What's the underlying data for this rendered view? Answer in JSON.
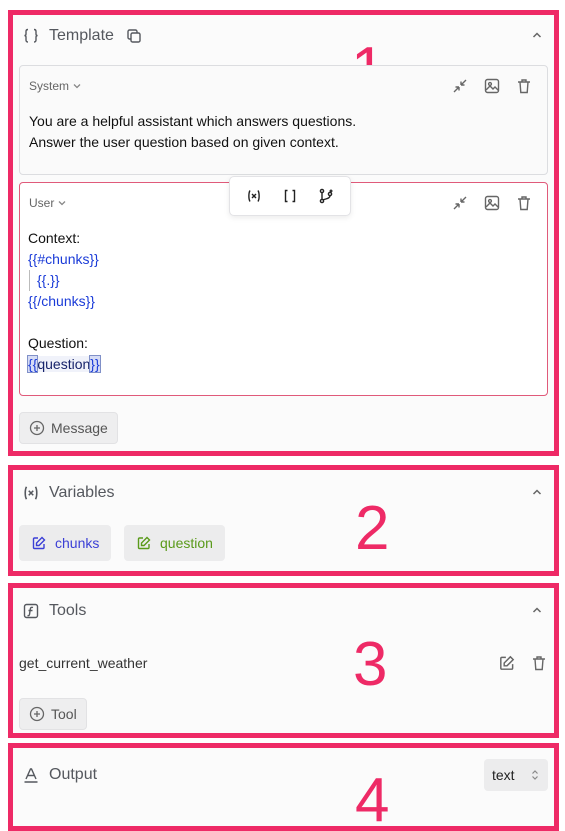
{
  "template": {
    "title": "Template",
    "number": "1",
    "system": {
      "role": "System",
      "lines": [
        "You are a helpful assistant which answers questions.",
        "Answer the user question based on given context."
      ]
    },
    "user": {
      "role": "User",
      "context_label": "Context:",
      "chunks_open": "{{#chunks}}",
      "chunk_item": "{{.}}",
      "chunks_close": "{{/chunks}}",
      "question_label": "Question:",
      "question_var_open": "{{",
      "question_var_name": "question",
      "question_var_close": "}}"
    },
    "add_message_label": "Message"
  },
  "variables": {
    "title": "Variables",
    "number": "2",
    "items": [
      {
        "label": "chunks",
        "color": "#3b3fd6"
      },
      {
        "label": "question",
        "color": "#5a9a1a"
      }
    ]
  },
  "tools": {
    "title": "Tools",
    "number": "3",
    "items": [
      {
        "name": "get_current_weather"
      }
    ],
    "add_tool_label": "Tool"
  },
  "output": {
    "title": "Output",
    "number": "4",
    "format_value": "text"
  },
  "colors": {
    "highlight": "#ee2a66",
    "template_var": "#1a3bd8"
  }
}
